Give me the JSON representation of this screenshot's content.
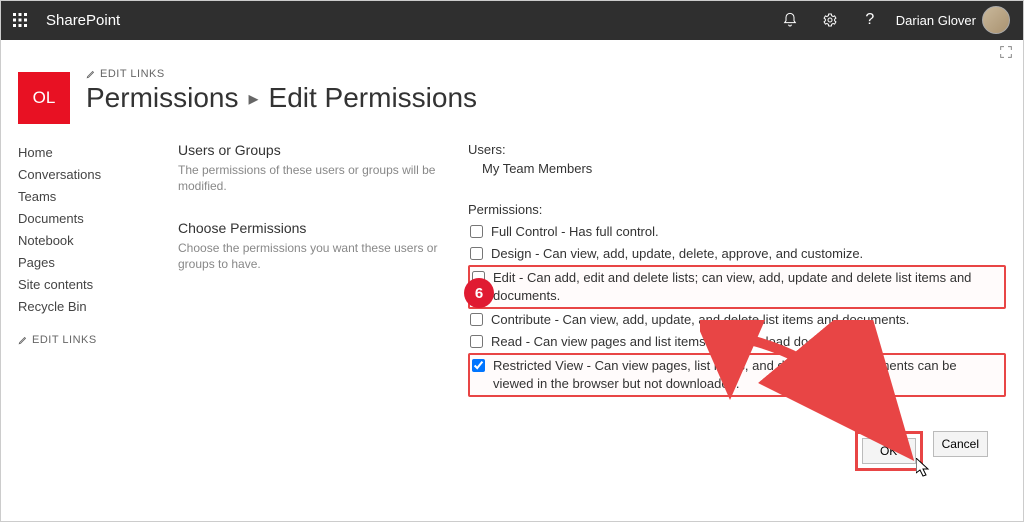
{
  "topbar": {
    "brand": "SharePoint",
    "username": "Darian Glover"
  },
  "site": {
    "logo_text": "OL",
    "edit_links": "EDIT LINKS",
    "breadcrumb_root": "Permissions",
    "breadcrumb_sep": "▸",
    "page_title": "Edit Permissions"
  },
  "nav": [
    "Home",
    "Conversations",
    "Teams",
    "Documents",
    "Notebook",
    "Pages",
    "Site contents",
    "Recycle Bin"
  ],
  "nav_edit_links": "EDIT LINKS",
  "sections": {
    "users_title": "Users or Groups",
    "users_desc": "The permissions of these users or groups will be modified.",
    "perms_title": "Choose Permissions",
    "perms_desc": "Choose the permissions you want these users or groups to have."
  },
  "fields": {
    "users_label": "Users:",
    "users_value": "My Team Members",
    "perms_label": "Permissions:"
  },
  "permissions": [
    {
      "label": "Full Control - Has full control.",
      "checked": false,
      "highlight": false
    },
    {
      "label": "Design - Can view, add, update, delete, approve, and customize.",
      "checked": false,
      "highlight": false
    },
    {
      "label": "Edit - Can add, edit and delete lists; can view, add, update and delete list items and documents.",
      "checked": false,
      "highlight": true
    },
    {
      "label": "Contribute - Can view, add, update, and delete list items and documents.",
      "checked": false,
      "highlight": false
    },
    {
      "label": "Read - Can view pages and list items and download documents.",
      "checked": false,
      "highlight": false
    },
    {
      "label": "Restricted View - Can view pages, list items, and documents. Documents can be viewed in the browser but not downloaded.",
      "checked": true,
      "highlight": true
    }
  ],
  "buttons": {
    "ok": "OK",
    "cancel": "Cancel"
  },
  "annotation": {
    "step_number": "6",
    "arrow_color": "#e84545"
  }
}
